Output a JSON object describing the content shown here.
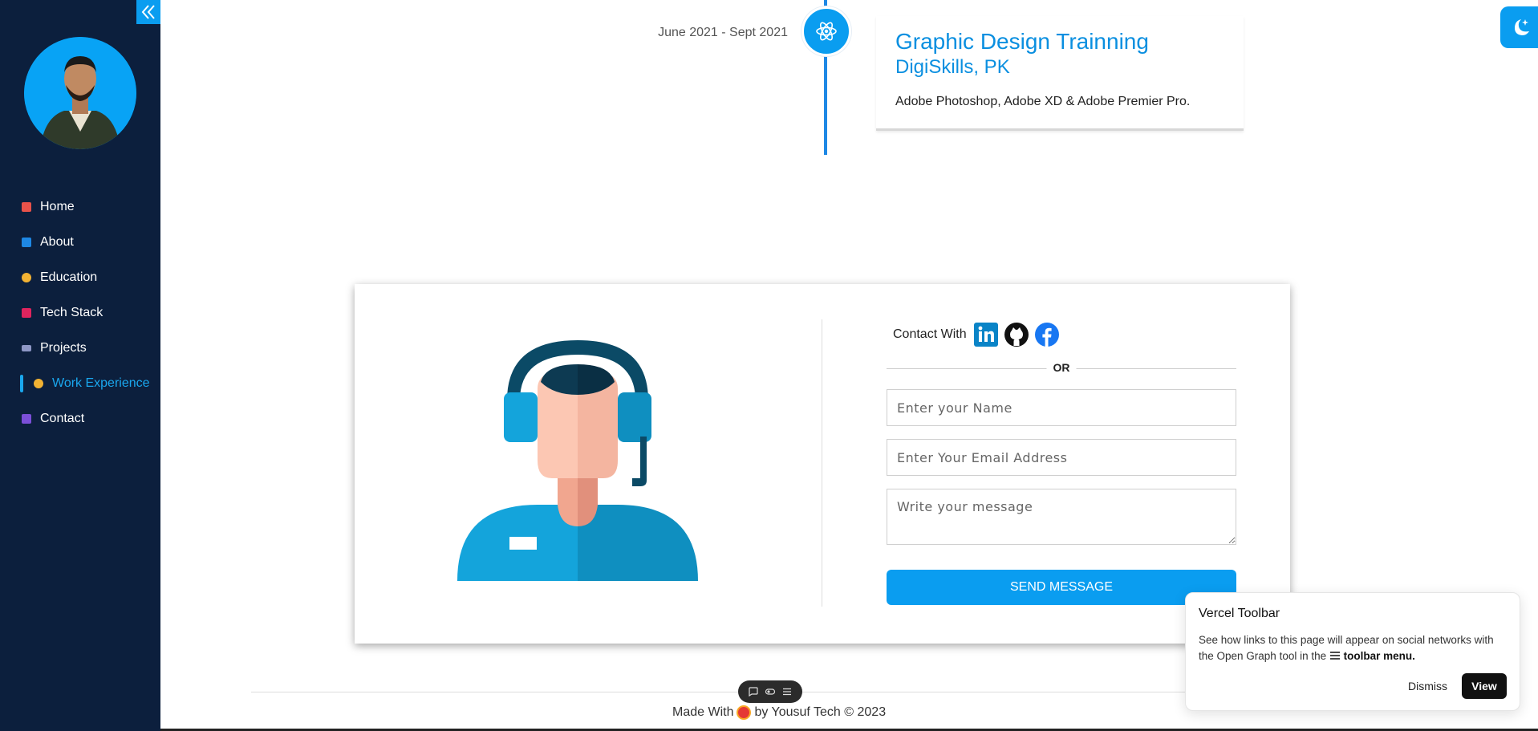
{
  "sidebar": {
    "items": [
      {
        "label": "Home",
        "icon": "home-icon",
        "color": "#e8524a"
      },
      {
        "label": "About",
        "icon": "info-icon",
        "color": "#1e88e5"
      },
      {
        "label": "Education",
        "icon": "student-icon",
        "color": "#f2b233"
      },
      {
        "label": "Tech Stack",
        "icon": "dna-icon",
        "color": "#e0245e"
      },
      {
        "label": "Projects",
        "icon": "keyboard-icon",
        "color": "#8e97c6"
      },
      {
        "label": "Work Experience",
        "icon": "worker-icon",
        "color": "#f2b233"
      },
      {
        "label": "Contact",
        "icon": "contact-card-icon",
        "color": "#7b4fd8"
      }
    ],
    "active": "Work Experience"
  },
  "timeline": {
    "date": "June 2021 - Sept 2021",
    "title": "Graphic Design Trainning",
    "org": "DigiSkills, PK",
    "description": "Adobe Photoshop, Adobe XD & Adobe Premier Pro."
  },
  "contact": {
    "contact_with_label": "Contact With",
    "or_text": "OR",
    "name_placeholder": "Enter your Name",
    "email_placeholder": "Enter Your Email Address",
    "message_placeholder": "Write your message",
    "send_label": "SEND MESSAGE"
  },
  "footer": {
    "prefix": "Made With",
    "suffix": "by Yousuf Tech © 2023"
  },
  "vercel": {
    "title": "Vercel Toolbar",
    "body_prefix": "See how links to this page will appear on social networks with the Open Graph tool in the",
    "body_link": "toolbar menu.",
    "dismiss_label": "Dismiss",
    "view_label": "View"
  },
  "colors": {
    "accent": "#0a9df0",
    "sidebar_bg": "#0c1f3d",
    "timeline_line": "#1e88e5"
  }
}
